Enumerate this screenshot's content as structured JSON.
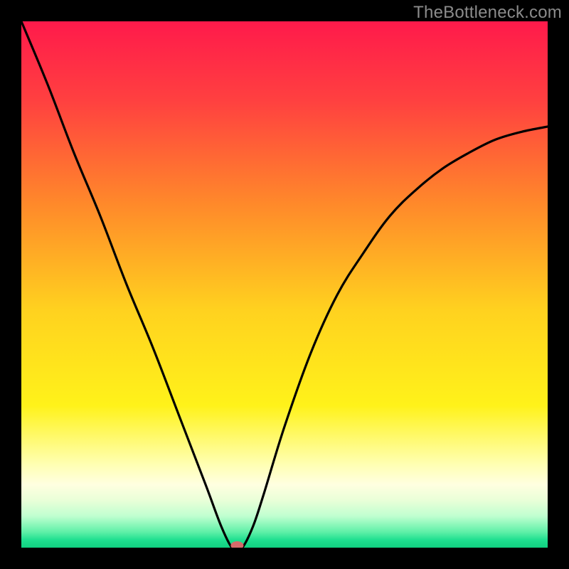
{
  "attribution": "TheBottleneck.com",
  "colors": {
    "frame": "#000000",
    "curve": "#000000",
    "marker_fill": "#d66a6a",
    "gradient_stops": [
      {
        "pos": 0.0,
        "color": "#ff1a4b"
      },
      {
        "pos": 0.15,
        "color": "#ff4040"
      },
      {
        "pos": 0.35,
        "color": "#ff8a2a"
      },
      {
        "pos": 0.55,
        "color": "#ffd21f"
      },
      {
        "pos": 0.73,
        "color": "#fff21a"
      },
      {
        "pos": 0.84,
        "color": "#ffffb0"
      },
      {
        "pos": 0.88,
        "color": "#ffffe0"
      },
      {
        "pos": 0.91,
        "color": "#e9ffd8"
      },
      {
        "pos": 0.94,
        "color": "#c0ffd0"
      },
      {
        "pos": 0.97,
        "color": "#60f0a8"
      },
      {
        "pos": 0.985,
        "color": "#20e090"
      },
      {
        "pos": 1.0,
        "color": "#10d080"
      }
    ]
  },
  "chart_data": {
    "type": "line",
    "title": "",
    "xlabel": "",
    "ylabel": "",
    "xlim": [
      0,
      100
    ],
    "ylim": [
      0,
      100
    ],
    "marker": {
      "x": 41,
      "y": 0
    },
    "series": [
      {
        "name": "curve",
        "x": [
          0,
          5,
          10,
          15,
          20,
          25,
          30,
          35,
          38,
          40,
          41,
          42,
          44,
          46,
          50,
          55,
          60,
          65,
          70,
          75,
          80,
          85,
          90,
          95,
          100
        ],
        "y": [
          100,
          88,
          75,
          63,
          50,
          38,
          25,
          12,
          4,
          0,
          0,
          0,
          4,
          10,
          23,
          37,
          48,
          56,
          63,
          68,
          72,
          75,
          77.5,
          79,
          80
        ]
      }
    ]
  }
}
